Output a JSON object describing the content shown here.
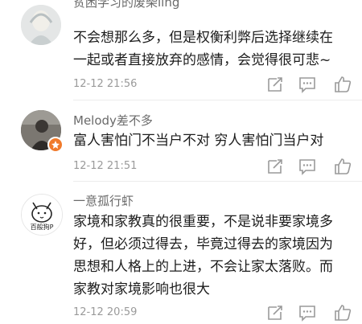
{
  "comments": [
    {
      "username": "贫困学习的废柴ling",
      "lines": [
        "不会想那么多，但是权衡利弊后选择继续在",
        "一起或者直接放弃的感情，会觉得很可悲~"
      ],
      "time": "12-12 21:56",
      "icons": [
        "forward-icon",
        "comment-icon",
        "like-icon"
      ]
    },
    {
      "username": "Melody差不多",
      "lines": [
        "富人害怕门不当户不对 穷人害怕门当户对"
      ],
      "time": "12-12 21:51",
      "icons": [
        "forward-icon",
        "comment-icon",
        "like-icon"
      ]
    },
    {
      "username": "一意孤行虾",
      "avatar_text": "百般狗P",
      "lines": [
        "家境和家教真的很重要，不是说非要家境多",
        "好，但必须过得去，毕竟过得去的家境因为",
        "思想和人格上的上进，不会让家太落败。而",
        "家教对家境影响也很大"
      ],
      "time": "12-12 20:59",
      "icons": [
        "forward-icon",
        "comment-icon",
        "like-icon"
      ]
    }
  ],
  "colors": {
    "text": "#1c1c1c",
    "username": "#6a6a6a",
    "meta": "#9a9a9a",
    "icon": "#9a9a9a",
    "badge": "#f07a2b"
  }
}
